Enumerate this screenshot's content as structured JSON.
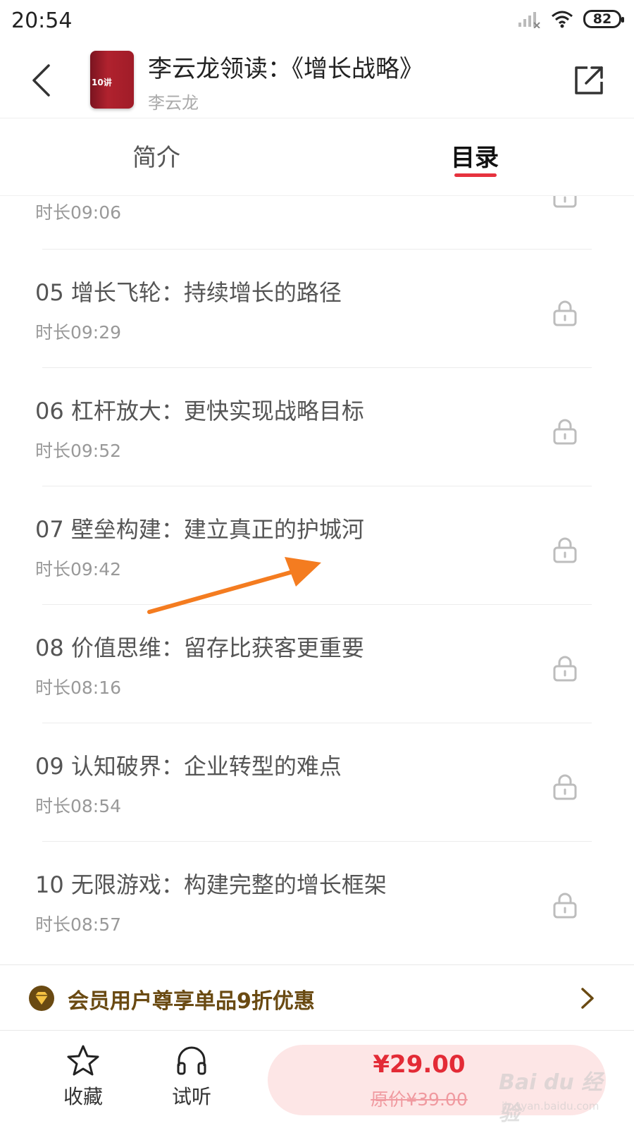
{
  "status_bar": {
    "time": "20:54",
    "battery": "82",
    "icons": [
      "signal-icon",
      "wifi-icon",
      "battery-icon"
    ]
  },
  "header": {
    "title": "李云龙领读：《增长战略》",
    "author": "李云龙",
    "cover_text": "10讲",
    "back_icon": "chevron-left-icon",
    "share_icon": "share-icon"
  },
  "tabs": [
    {
      "label": "简介",
      "active": false
    },
    {
      "label": "目录",
      "active": true
    }
  ],
  "accent_color": "#e6323e",
  "chapters": [
    {
      "title": "",
      "duration": "时长09:06",
      "locked": true
    },
    {
      "title": "05 增长飞轮：持续增长的路径",
      "duration": "时长09:29",
      "locked": true
    },
    {
      "title": "06 杠杆放大：更快实现战略目标",
      "duration": "时长09:52",
      "locked": true
    },
    {
      "title": "07 壁垒构建：建立真正的护城河",
      "duration": "时长09:42",
      "locked": true
    },
    {
      "title": "08 价值思维：留存比获客更重要",
      "duration": "时长08:16",
      "locked": true
    },
    {
      "title": "09 认知破界：企业转型的难点",
      "duration": "时长08:54",
      "locked": true
    },
    {
      "title": "10 无限游戏：构建完整的增长框架",
      "duration": "时长08:57",
      "locked": true
    }
  ],
  "member_banner": {
    "text": "会员用户尊享单品9折优惠",
    "color": "#6a4a12"
  },
  "bottom_bar": {
    "favorite_label": "收藏",
    "trial_label": "试听",
    "price": "¥29.00",
    "original_price": "原价¥39.00",
    "price_color": "#e32b36"
  },
  "watermark": {
    "main": "Bai du 经验",
    "sub": "jingyan.baidu.com"
  }
}
